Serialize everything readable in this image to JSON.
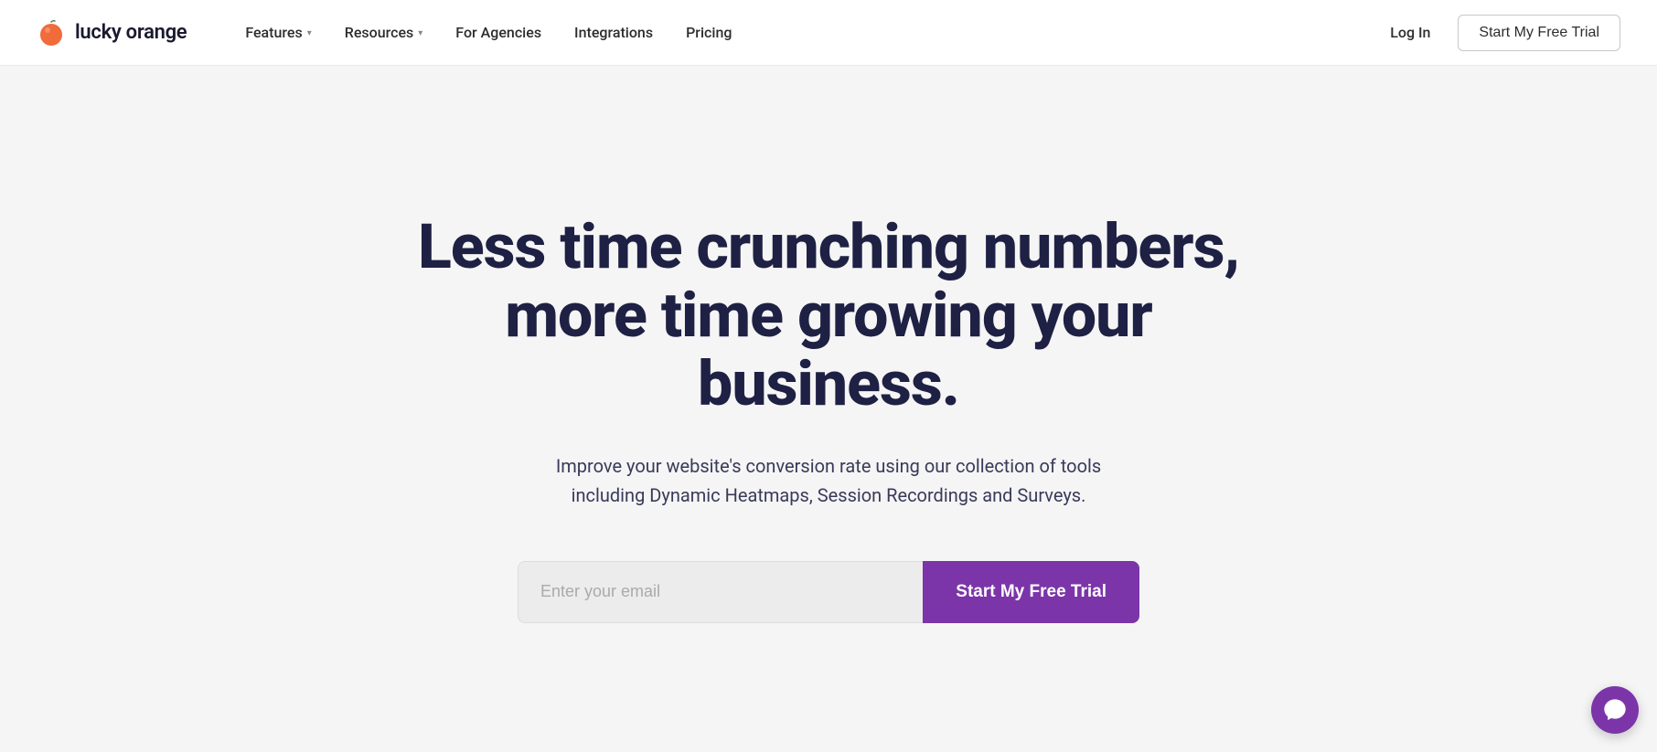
{
  "brand": {
    "name": "lucky orange",
    "logo_alt": "Lucky Orange logo"
  },
  "nav": {
    "links": [
      {
        "label": "Features",
        "has_dropdown": true
      },
      {
        "label": "Resources",
        "has_dropdown": true
      },
      {
        "label": "For Agencies",
        "has_dropdown": false
      },
      {
        "label": "Integrations",
        "has_dropdown": false
      },
      {
        "label": "Pricing",
        "has_dropdown": false
      }
    ],
    "login_label": "Log In",
    "trial_label": "Start My Free Trial"
  },
  "hero": {
    "headline_line1": "Less time crunching numbers,",
    "headline_line2": "more time growing your business.",
    "subtext": "Improve your website's conversion rate using our collection of tools including Dynamic Heatmaps, Session Recordings and Surveys.",
    "email_placeholder": "Enter your email",
    "cta_label": "Start My Free Trial"
  },
  "colors": {
    "brand_purple": "#7b35a8",
    "nav_bg": "#ffffff",
    "hero_bg": "#f5f5f5",
    "headline_color": "#1e2044",
    "subtext_color": "#3a3a5a"
  }
}
